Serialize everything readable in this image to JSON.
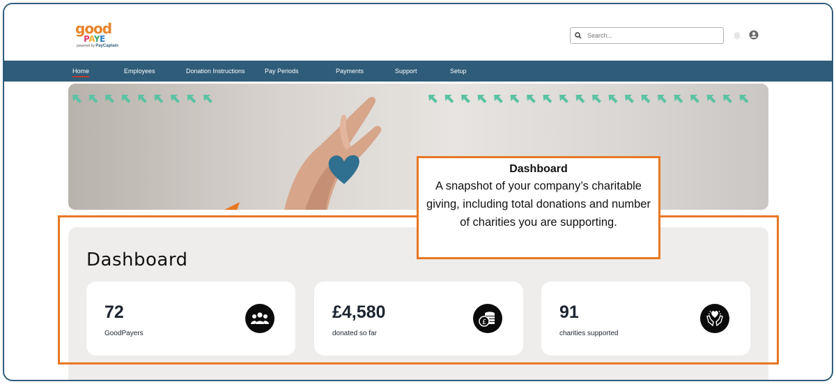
{
  "brand": {
    "word": "good",
    "paye_letters": [
      "P",
      "A",
      "Y",
      "E"
    ],
    "powered_by": "powered by",
    "powered_brand": "PayCaptain"
  },
  "search": {
    "placeholder": "Search...",
    "icon": "search-icon"
  },
  "header_icons": {
    "notifications": "bell-icon",
    "profile": "user-icon"
  },
  "nav": {
    "items": [
      {
        "label": "Home",
        "active": true
      },
      {
        "label": "Employees"
      },
      {
        "label": "Donation Instructions"
      },
      {
        "label": "Pay Periods"
      },
      {
        "label": "Payments"
      },
      {
        "label": "Support"
      },
      {
        "label": "Setup"
      }
    ]
  },
  "callout": {
    "title": "Dashboard",
    "description": "A snapshot of your company’s charitable giving, including total donations and number of charities you are supporting."
  },
  "dashboard": {
    "title": "Dashboard",
    "cards": [
      {
        "value": "72",
        "label": "GoodPayers",
        "icon": "people-group-icon"
      },
      {
        "value": "£4,580",
        "label": "donated so far",
        "icon": "coins-pound-icon"
      },
      {
        "value": "91",
        "label": "charities supported",
        "icon": "heart-hands-icon"
      }
    ]
  },
  "colors": {
    "nav_bg": "#2e5c79",
    "accent_orange": "#e87722",
    "arrow_teal": "#5cc2a4",
    "card_value": "#1b2430",
    "dash_bg": "#eeedec"
  }
}
